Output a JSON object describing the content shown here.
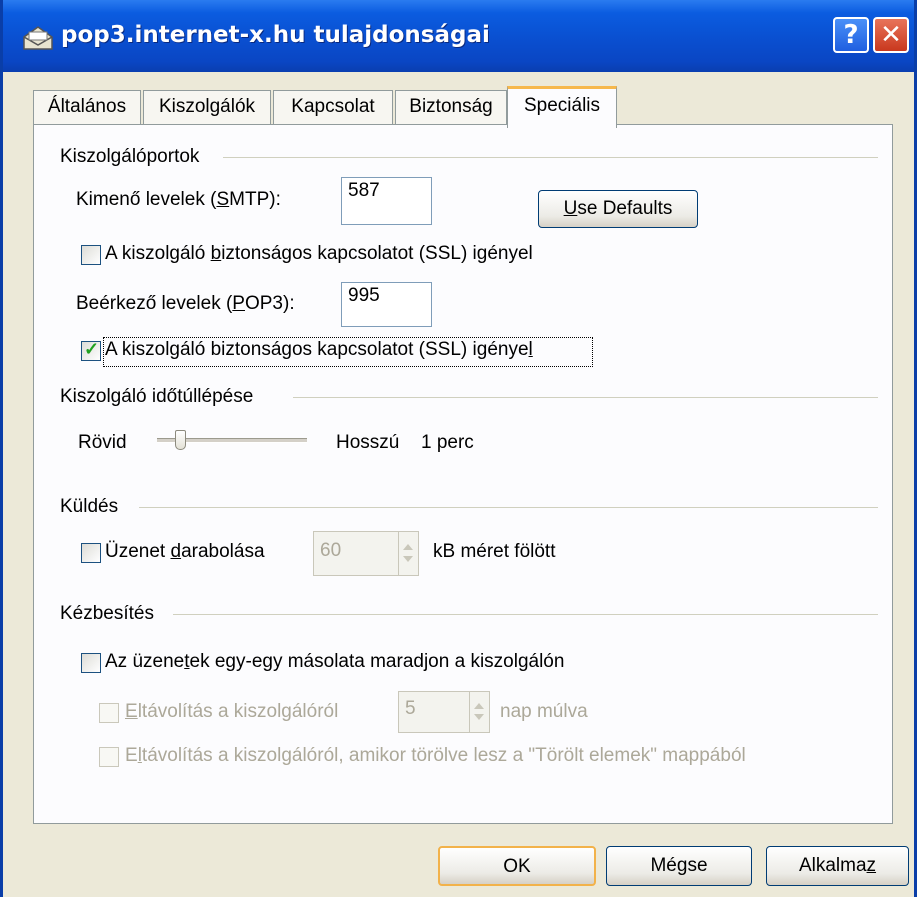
{
  "window": {
    "title": "pop3.internet-x.hu tulajdonságai",
    "help_glyph": "?",
    "close_glyph": "✕"
  },
  "tabs": [
    {
      "label": "Általános",
      "active": false
    },
    {
      "label": "Kiszolgálók",
      "active": false
    },
    {
      "label": "Kapcsolat",
      "active": false
    },
    {
      "label": "Biztonság",
      "active": false
    },
    {
      "label": "Speciális",
      "active": true
    }
  ],
  "ports": {
    "group_label": "Kiszolgálóportok",
    "smtp_label": "Kimenő levelek (SMTP):",
    "smtp_value": "587",
    "use_defaults_label": "Use Defaults",
    "smtp_ssl_label": "A kiszolgáló biztonságos kapcsolatot (SSL) igényel",
    "smtp_ssl_checked": false,
    "pop3_label": "Beérkező levelek (POP3):",
    "pop3_value": "995",
    "pop3_ssl_label": "A kiszolgáló biztonságos kapcsolatot (SSL) igényel",
    "pop3_ssl_checked": true
  },
  "timeout": {
    "group_label": "Kiszolgáló időtúllépése",
    "short_label": "Rövid",
    "long_label": "Hosszú",
    "value_label": "1 perc",
    "slider_fraction": 0.15
  },
  "sending": {
    "group_label": "Küldés",
    "split_label": "Üzenet darabolása",
    "split_checked": false,
    "split_value": "60",
    "split_suffix": "kB méret fölött"
  },
  "delivery": {
    "group_label": "Kézbesítés",
    "keep_copy_label": "Az üzenetek egy-egy másolata maradjon a kiszolgálón",
    "keep_copy_checked": false,
    "remove_after_label": "Eltávolítás a kiszolgálóról",
    "remove_after_value": "5",
    "remove_after_suffix": "nap múlva",
    "remove_deleted_label": "Eltávolítás a kiszolgálóról, amikor törölve lesz a \"Törölt elemek\" mappából"
  },
  "buttons": {
    "ok": "OK",
    "cancel": "Mégse",
    "apply": "Alkalmaz"
  },
  "colors": {
    "titlebar": "#0A4FD0",
    "check_green": "#21A121",
    "active_tab_accent": "#F6B84C"
  }
}
